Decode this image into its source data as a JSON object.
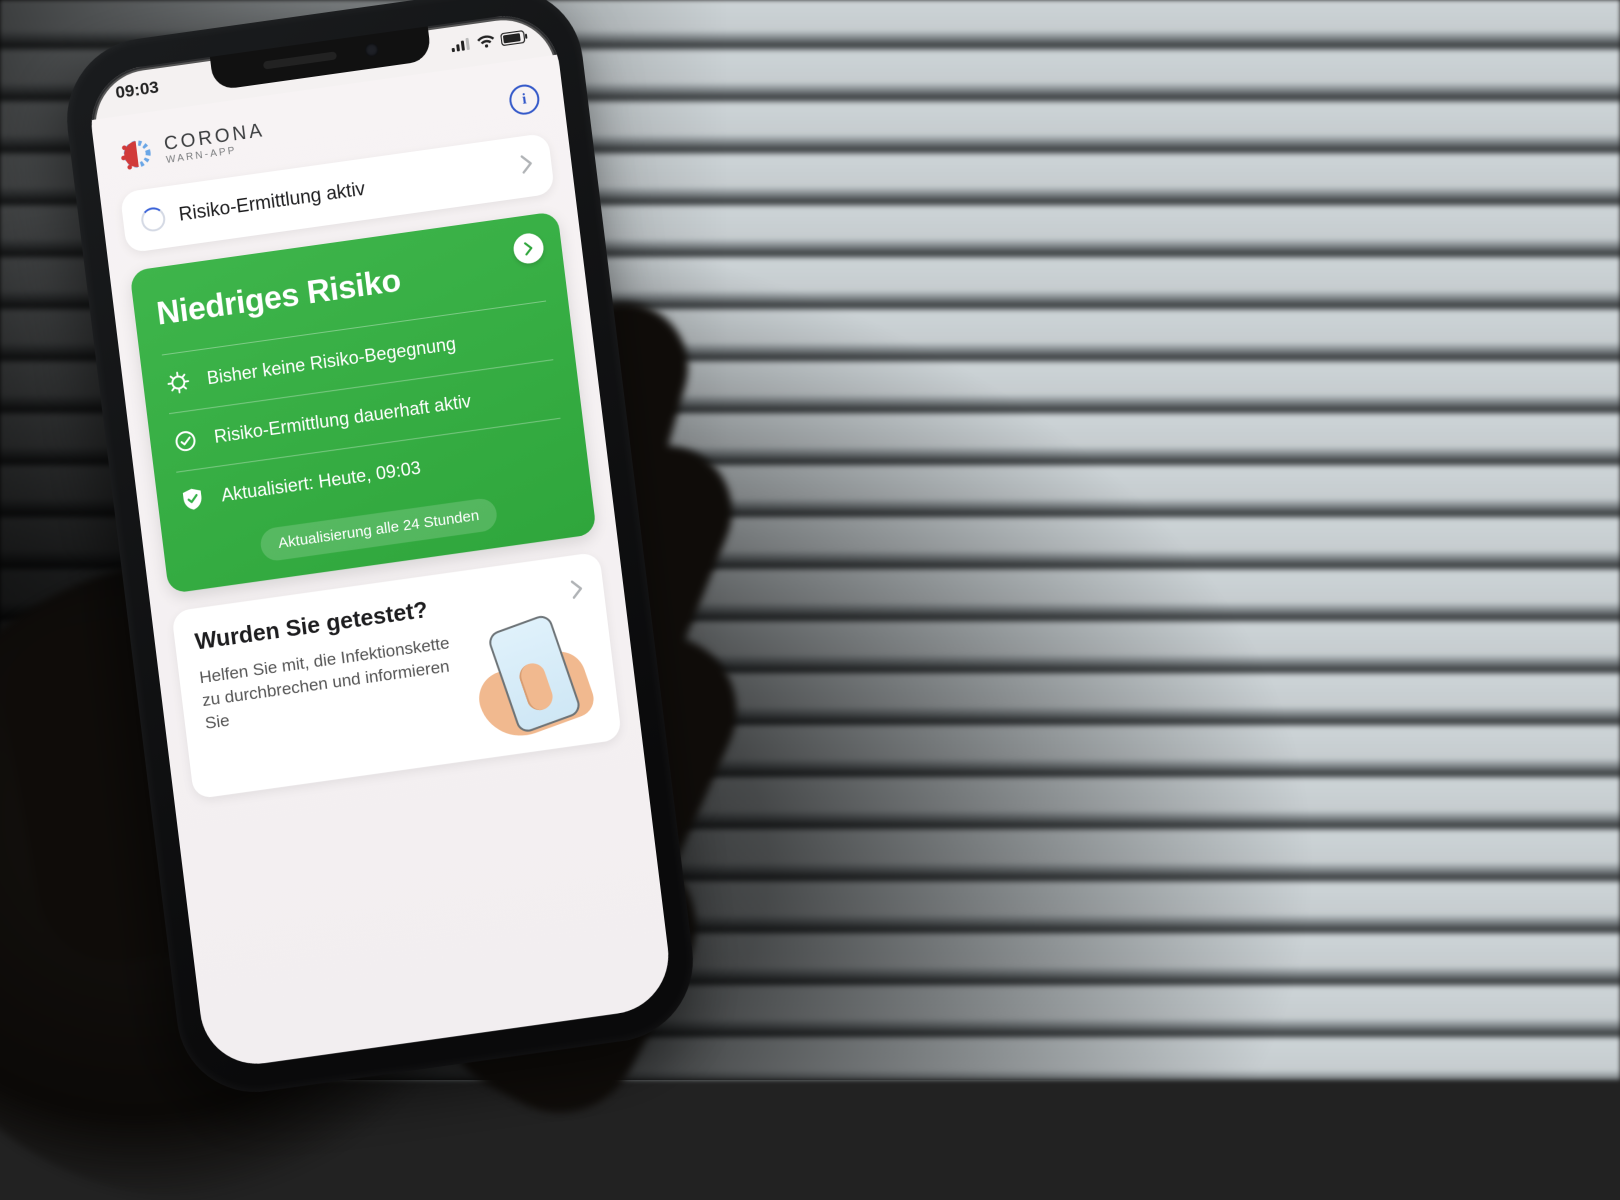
{
  "status": {
    "time": "09:03"
  },
  "header": {
    "brand_line1": "CORONA",
    "brand_line2": "WARN-APP"
  },
  "exposure_row": {
    "label": "Risiko-Ermittlung aktiv"
  },
  "risk_card": {
    "title": "Niedriges Risiko",
    "items": [
      {
        "text": "Bisher keine Risiko-Begegnung"
      },
      {
        "text": "Risiko-Ermittlung dauerhaft aktiv"
      },
      {
        "text": "Aktualisiert: Heute, 09:03"
      }
    ],
    "footer_pill": "Aktualisierung alle 24 Stunden"
  },
  "tested_card": {
    "title": "Wurden Sie getestet?",
    "body": "Helfen Sie mit, die Infektionskette zu durchbrechen und informieren Sie"
  },
  "colors": {
    "accent_green": "#34b148",
    "accent_blue": "#3358c9"
  }
}
